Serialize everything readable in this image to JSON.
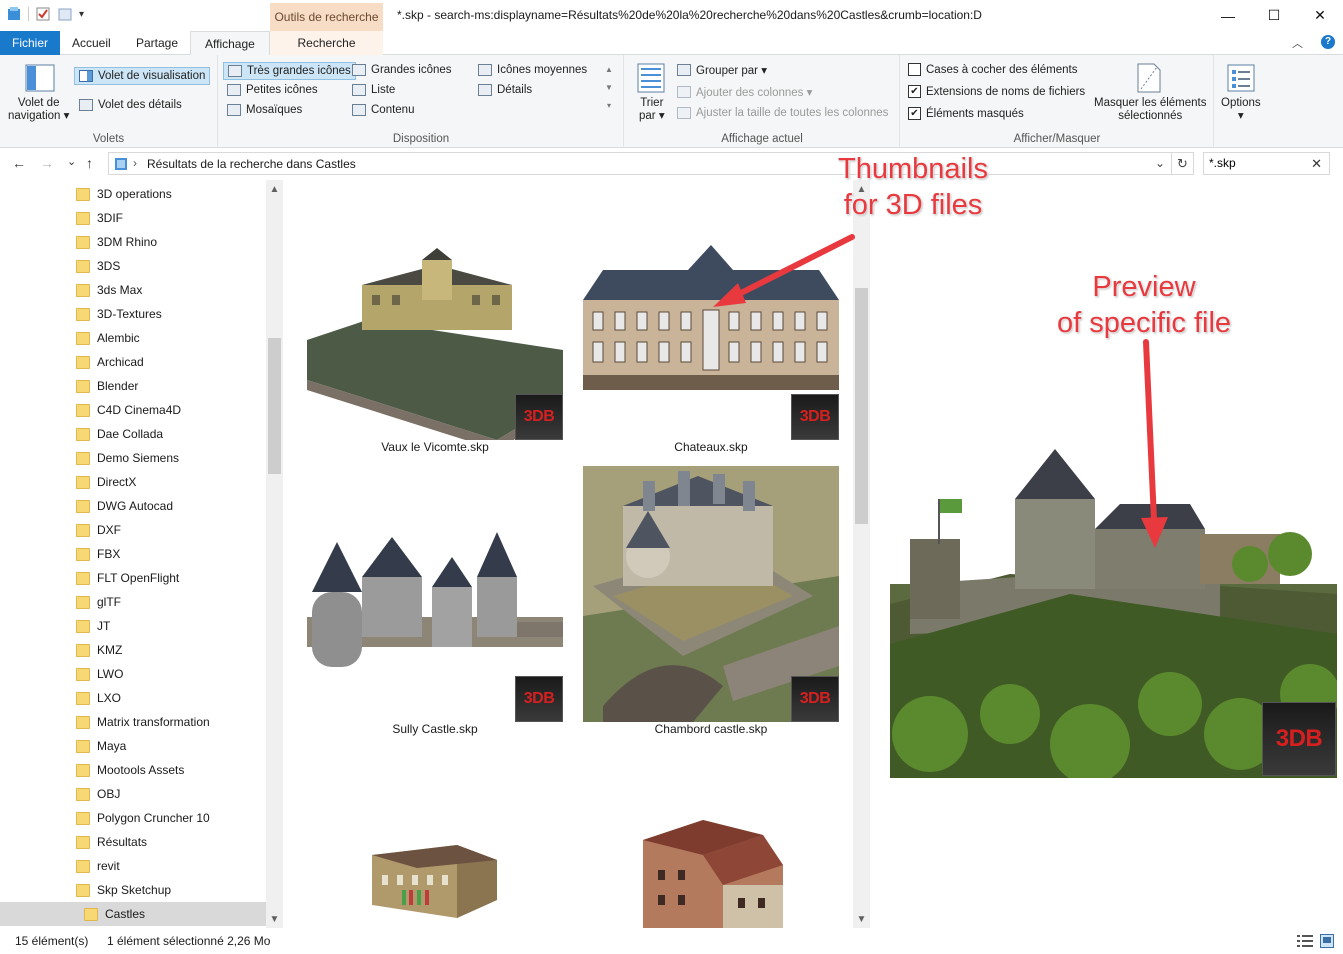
{
  "window": {
    "title": "*.skp - search-ms:displayname=Résultats%20de%20la%20recherche%20dans%20Castles&crumb=location:D",
    "context_tab_group": "Outils de recherche",
    "minimize": "—",
    "maximize": "☐",
    "close": "✕"
  },
  "tabs": {
    "file": "Fichier",
    "home": "Accueil",
    "share": "Partage",
    "view": "Affichage",
    "search": "Recherche",
    "collapse": "︿",
    "help": "?"
  },
  "ribbon": {
    "panes": {
      "navigation_pane": "Volet de navigation",
      "navigation_pane_line1": "Volet de",
      "navigation_pane_line2": "navigation ▾",
      "preview_pane": "Volet de visualisation",
      "details_pane": "Volet des détails",
      "label": "Volets"
    },
    "layout": {
      "items": [
        "Très grandes icônes",
        "Grandes icônes",
        "Icônes moyennes",
        "Petites icônes",
        "Liste",
        "Détails",
        "Mosaïques",
        "Contenu"
      ],
      "label": "Disposition"
    },
    "current_view": {
      "sort_line1": "Trier",
      "sort_line2": "par ▾",
      "group_by": "Grouper par ▾",
      "add_columns": "Ajouter des colonnes ▾",
      "size_columns": "Ajuster la taille de toutes les colonnes",
      "label": "Affichage actuel"
    },
    "show_hide": {
      "item_checkboxes": "Cases à cocher des éléments",
      "item_checkboxes_checked": false,
      "file_extensions": "Extensions de noms de fichiers",
      "file_extensions_checked": true,
      "hidden_items": "Éléments masqués",
      "hidden_items_checked": true,
      "hide_selected_line1": "Masquer les éléments",
      "hide_selected_line2": "sélectionnés",
      "label": "Afficher/Masquer"
    },
    "options": {
      "label": "Options",
      "arrow": "▾"
    }
  },
  "address": {
    "back": "←",
    "forward": "→",
    "recent": "⌄",
    "up": "↑",
    "path_sep": "›",
    "path": "Résultats de la recherche dans Castles",
    "dropdown": "⌄",
    "refresh": "↻",
    "search_value": "*.skp",
    "search_clear": "✕"
  },
  "nav_tree": {
    "items": [
      "3D operations",
      "3DIF",
      "3DM Rhino",
      "3DS",
      "3ds Max",
      "3D-Textures",
      "Alembic",
      "Archicad",
      "Blender",
      "C4D Cinema4D",
      "Dae Collada",
      "Demo Siemens",
      "DirectX",
      "DWG Autocad",
      "DXF",
      "FBX",
      "FLT OpenFlight",
      "glTF",
      "JT",
      "KMZ",
      "LWO",
      "LXO",
      "Matrix transformation",
      "Maya",
      "Mootools Assets",
      "OBJ",
      "Polygon Cruncher 10",
      "Résultats",
      "revit",
      "Skp Sketchup",
      "Castles"
    ],
    "selected": "Castles",
    "scroll_up": "▲",
    "scroll_down": "▼"
  },
  "files": [
    {
      "name": "Vaux le Vicomte.skp",
      "badge": "3DB"
    },
    {
      "name": "Chateaux.skp",
      "badge": "3DB"
    },
    {
      "name": "Sully Castle.skp",
      "badge": "3DB"
    },
    {
      "name": "Chambord castle.skp",
      "badge": "3DB"
    }
  ],
  "preview": {
    "badge": "3DB"
  },
  "annotations": {
    "thumbnails_line1": "Thumbnails",
    "thumbnails_line2": "for 3D files",
    "preview_line1": "Preview",
    "preview_line2": "of specific file"
  },
  "status": {
    "count": "15 élément(s)",
    "selection": "1 élément sélectionné  2,26 Mo"
  }
}
